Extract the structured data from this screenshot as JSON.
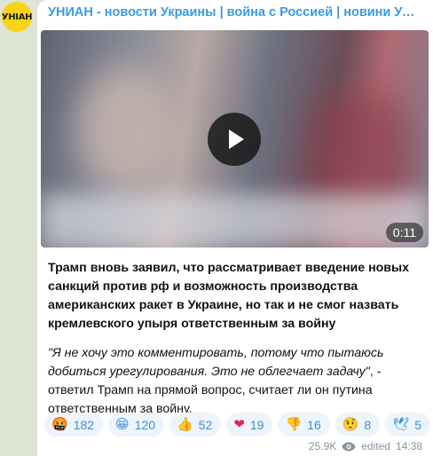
{
  "channel": {
    "avatar_text": "УНІАН",
    "title": "УНИАН - новости Украины | война с Россией | новини Україні..."
  },
  "video": {
    "duration": "0:11",
    "play_icon": "play-icon"
  },
  "post": {
    "headline": "Трамп вновь заявил, что рассматривает введение новых санкций против рф и возможность производства американских ракет в Украине, но так и не смог назвать кремлевского упыря ответственным за войну",
    "quote": "\"Я не хочу это комментировать, потому что пытаюсь добиться урегулирования. Это не облегчает задачу\"",
    "rest": ", - ответил Трамп на прямой вопрос, считает ли он путина ответственным за войну."
  },
  "reactions": [
    {
      "emoji": "🤬",
      "count": "182"
    },
    {
      "emoji": "😁",
      "count": "120"
    },
    {
      "emoji": "👍",
      "count": "52"
    },
    {
      "emoji": "❤",
      "count": "19"
    },
    {
      "emoji": "👎",
      "count": "16"
    },
    {
      "emoji": "🤨",
      "count": "8"
    },
    {
      "emoji": "🕊",
      "count": "5"
    }
  ],
  "meta": {
    "views": "25.9K",
    "edited_label": "edited",
    "time": "14:38"
  },
  "colors": {
    "accent": "#3a9ae0",
    "avatar_bg": "#f7d417",
    "reaction_bg": "#eef4fb"
  }
}
